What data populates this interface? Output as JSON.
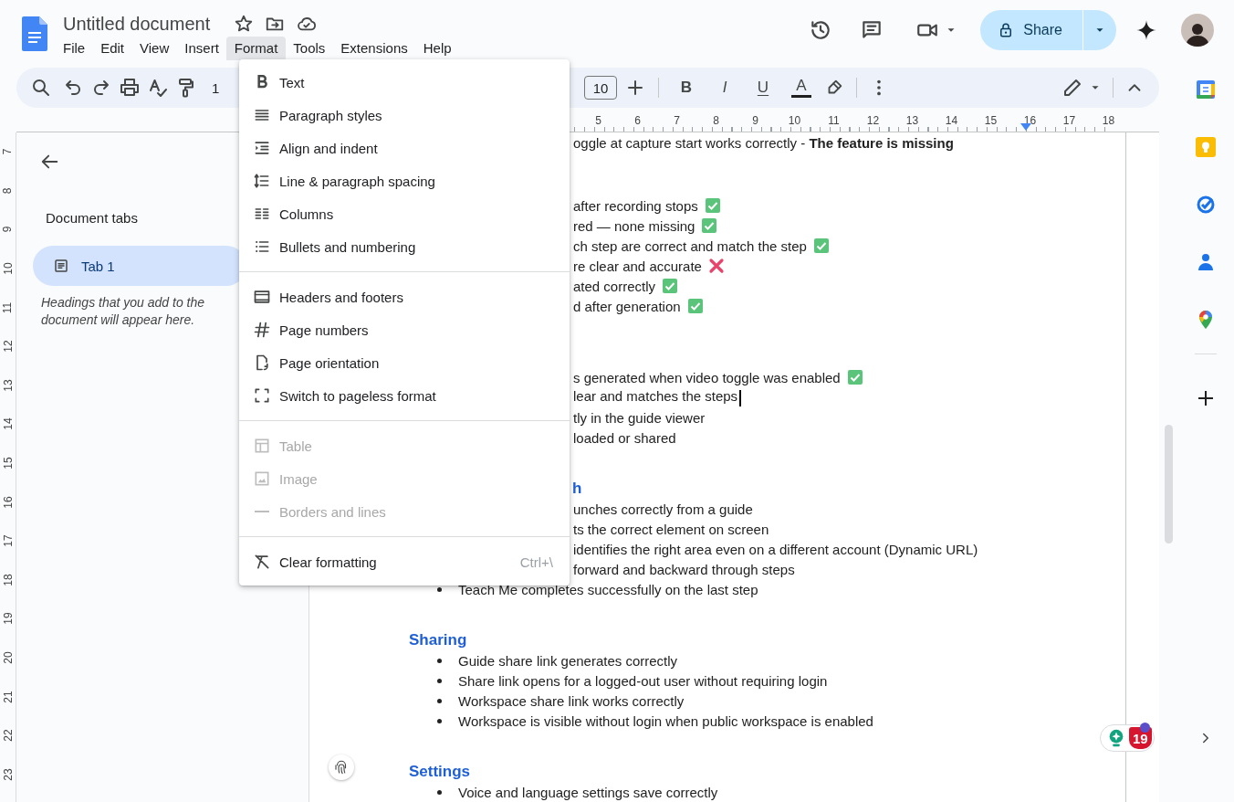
{
  "app": {
    "title": "Untitled document"
  },
  "menubar": [
    {
      "label": "File",
      "selected": false
    },
    {
      "label": "Edit",
      "selected": false
    },
    {
      "label": "View",
      "selected": false
    },
    {
      "label": "Insert",
      "selected": false
    },
    {
      "label": "Format",
      "selected": true
    },
    {
      "label": "Tools",
      "selected": false
    },
    {
      "label": "Extensions",
      "selected": false
    },
    {
      "label": "Help",
      "selected": false
    }
  ],
  "share": {
    "label": "Share"
  },
  "toolbar": {
    "zoom": "1",
    "font_size": "10",
    "format_buttons": [
      {
        "label": "B",
        "kind": "bold"
      },
      {
        "label": "I",
        "kind": "italic"
      },
      {
        "label": "U",
        "kind": "underline"
      },
      {
        "label": "A",
        "kind": "text-color"
      }
    ]
  },
  "format_menu": {
    "groups": [
      [
        {
          "label": "Text",
          "disabled": false
        },
        {
          "label": "Paragraph styles",
          "disabled": false
        },
        {
          "label": "Align and indent",
          "disabled": false
        },
        {
          "label": "Line & paragraph spacing",
          "disabled": false
        },
        {
          "label": "Columns",
          "disabled": false
        },
        {
          "label": "Bullets and numbering",
          "disabled": false
        }
      ],
      [
        {
          "label": "Headers and footers",
          "disabled": false
        },
        {
          "label": "Page numbers",
          "disabled": false
        },
        {
          "label": "Page orientation",
          "disabled": false
        },
        {
          "label": "Switch to pageless format",
          "disabled": false
        }
      ],
      [
        {
          "label": "Table",
          "disabled": true
        },
        {
          "label": "Image",
          "disabled": true
        },
        {
          "label": "Borders and lines",
          "disabled": true
        }
      ],
      [
        {
          "label": "Clear formatting",
          "disabled": false,
          "shortcut": "Ctrl+\\"
        }
      ]
    ]
  },
  "ruler": {
    "horizontal": [
      "5",
      "6",
      "7",
      "8",
      "9",
      "10",
      "11",
      "12",
      "13",
      "14",
      "15",
      "16",
      "17",
      "18"
    ],
    "vertical": [
      "7",
      "8",
      "9",
      "10",
      "11",
      "12",
      "13",
      "14",
      "15",
      "16",
      "17",
      "18",
      "19",
      "20",
      "21",
      "22",
      "23"
    ]
  },
  "sidebar": {
    "title": "Document tabs",
    "tabs": [
      {
        "label": "Tab 1",
        "selected": true
      }
    ],
    "hint": "Headings that you add to the document will appear here."
  },
  "document": {
    "sections": [
      {
        "kind": "continued",
        "fragments": [
          {
            "kind": "plain",
            "text": "oggle at capture start works correctly - **The feature is missing**",
            "cursor": false
          }
        ]
      },
      {
        "kind": "section",
        "fragments": [
          {
            "kind": "check",
            "text": "after recording stops",
            "cursor": false
          },
          {
            "kind": "check",
            "text": "red — none missing",
            "cursor": false
          },
          {
            "kind": "check",
            "text": "ch step are correct and match the step",
            "cursor": false
          },
          {
            "kind": "cross",
            "text": "re clear and accurate",
            "cursor": false
          },
          {
            "kind": "check",
            "text": "ated correctly",
            "cursor": false
          },
          {
            "kind": "check",
            "text": "d after generation",
            "cursor": false
          }
        ]
      },
      {
        "kind": "section",
        "fragments": [
          {
            "kind": "check",
            "text": "s generated when video toggle was enabled",
            "cursor": false
          },
          {
            "kind": "plain",
            "text": "lear and matches the steps",
            "cursor": true
          },
          {
            "kind": "plain",
            "text": "tly in the guide viewer",
            "cursor": false
          },
          {
            "kind": "plain",
            "text": "loaded or shared",
            "cursor": false
          }
        ]
      },
      {
        "kind": "section",
        "heading_fragment": "h",
        "fragments": [
          {
            "kind": "plain",
            "text": "unches correctly from a guide",
            "cursor": false
          },
          {
            "kind": "plain",
            "text": "ts the correct element on screen",
            "cursor": false
          },
          {
            "kind": "plain",
            "text": "identifies the right area even on a different account (Dynamic URL)",
            "cursor": false
          },
          {
            "kind": "plain",
            "text": "forward and backward through steps",
            "cursor": false
          }
        ],
        "items": [
          {
            "kind": "plain",
            "text": "Teach Me completes successfully on the last step",
            "cursor": false
          }
        ]
      },
      {
        "kind": "section",
        "heading": "Sharing",
        "items": [
          {
            "kind": "plain",
            "text": "Guide share link generates correctly",
            "cursor": false
          },
          {
            "kind": "plain",
            "text": "Share link opens for a logged-out user without requiring login",
            "cursor": false
          },
          {
            "kind": "plain",
            "text": "Workspace share link works correctly",
            "cursor": false
          },
          {
            "kind": "plain",
            "text": "Workspace is visible without login when public workspace is enabled",
            "cursor": false
          }
        ]
      },
      {
        "kind": "section",
        "heading": "Settings",
        "items": [
          {
            "kind": "plain",
            "text": "Voice and language settings save correctly",
            "cursor": false
          }
        ]
      }
    ]
  },
  "addon_badge": {
    "count": "19"
  }
}
